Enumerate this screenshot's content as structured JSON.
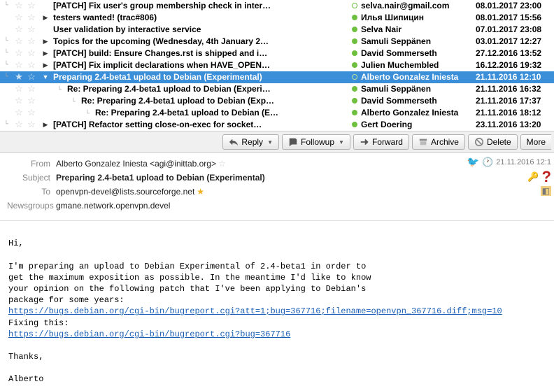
{
  "threads": [
    {
      "tree": "└",
      "star": false,
      "expand": "",
      "indent": 0,
      "subject": "[PATCH] Fix user's group membership check in inter…",
      "dot": "ring",
      "from": "selva.nair@gmail.com",
      "date": "08.01.2017 23:00"
    },
    {
      "tree": "",
      "star": false,
      "expand": "▶",
      "indent": 0,
      "subject": "testers wanted! (trac#806)",
      "dot": "solid",
      "from": "Илья Шипицин",
      "date": "08.01.2017 15:56"
    },
    {
      "tree": "",
      "star": false,
      "expand": "",
      "indent": 0,
      "subject": "User validation by interactive service",
      "dot": "solid",
      "from": "Selva Nair",
      "date": "07.01.2017 23:08"
    },
    {
      "tree": "└",
      "star": false,
      "expand": "▶",
      "indent": 0,
      "subject": "Topics for the upcoming (Wednesday, 4th January 2…",
      "dot": "solid",
      "from": "Samuli Seppänen",
      "date": "03.01.2017 12:27"
    },
    {
      "tree": "└",
      "star": false,
      "expand": "▶",
      "indent": 0,
      "subject": "[PATCH] build: Ensure Changes.rst is shipped and i…",
      "dot": "solid",
      "from": "David Sommerseth",
      "date": "27.12.2016 13:52"
    },
    {
      "tree": "└",
      "star": false,
      "expand": "▶",
      "indent": 0,
      "subject": "[PATCH] Fix implicit declarations when HAVE_OPEN…",
      "dot": "solid",
      "from": "Julien Muchembled",
      "date": "16.12.2016 19:32"
    },
    {
      "tree": "└",
      "star": true,
      "expand": "▼",
      "indent": 0,
      "subject": "Preparing 2.4-beta1 upload to Debian (Experimental)",
      "dot": "ring",
      "from": "Alberto Gonzalez Iniesta",
      "date": "21.11.2016 12:10",
      "selected": true
    },
    {
      "tree": "",
      "star": false,
      "expand": "",
      "indent": 20,
      "subject": "Re: Preparing 2.4-beta1 upload to Debian (Experi…",
      "dot": "solid",
      "from": "Samuli Seppänen",
      "date": "21.11.2016 16:32"
    },
    {
      "tree": "",
      "star": false,
      "expand": "",
      "indent": 40,
      "subject": "Re: Preparing 2.4-beta1 upload to Debian (Exp…",
      "dot": "solid",
      "from": "David Sommerseth",
      "date": "21.11.2016 17:37"
    },
    {
      "tree": "",
      "star": false,
      "expand": "",
      "indent": 60,
      "subject": "Re: Preparing 2.4-beta1 upload to Debian (E…",
      "dot": "solid",
      "from": "Alberto Gonzalez Iniesta",
      "date": "21.11.2016 18:12"
    },
    {
      "tree": "└",
      "star": false,
      "expand": "▶",
      "indent": 0,
      "subject": "[PATCH] Refactor setting close-on-exec for socket…",
      "dot": "solid",
      "from": "Gert Doering",
      "date": "23.11.2016 13:20"
    }
  ],
  "toolbar": {
    "reply": "Reply",
    "followup": "Followup",
    "forward": "Forward",
    "archive": "Archive",
    "delete": "Delete",
    "more": "More"
  },
  "header": {
    "from_label": "From",
    "from_value": "Alberto Gonzalez Iniesta <agi@inittab.org>",
    "subject_label": "Subject",
    "subject_value": "Preparing 2.4-beta1 upload to Debian (Experimental)",
    "to_label": "To",
    "to_value": "openvpn-devel@lists.sourceforge.net",
    "newsgroups_label": "Newsgroups",
    "newsgroups_value": "gmane.network.openvpn.devel",
    "date": "21.11.2016 12:1"
  },
  "body": {
    "greeting": "Hi,",
    "p1a": "I'm preparing an upload to Debian Experimental of 2.4-beta1 in order to",
    "p1b": "get the maximum exposition as possible. In the meantime I'd like to know",
    "p1c": "your opinion on the following patch that I've been applying to Debian's",
    "p1d": "package for some years:",
    "link1": "https://bugs.debian.org/cgi-bin/bugreport.cgi?att=1;bug=367716;filename=openvpn_367716.diff;msg=10",
    "p2": "Fixing this:",
    "link2": "https://bugs.debian.org/cgi-bin/bugreport.cgi?bug=367716",
    "thanks": "Thanks,",
    "sig": "Alberto"
  }
}
